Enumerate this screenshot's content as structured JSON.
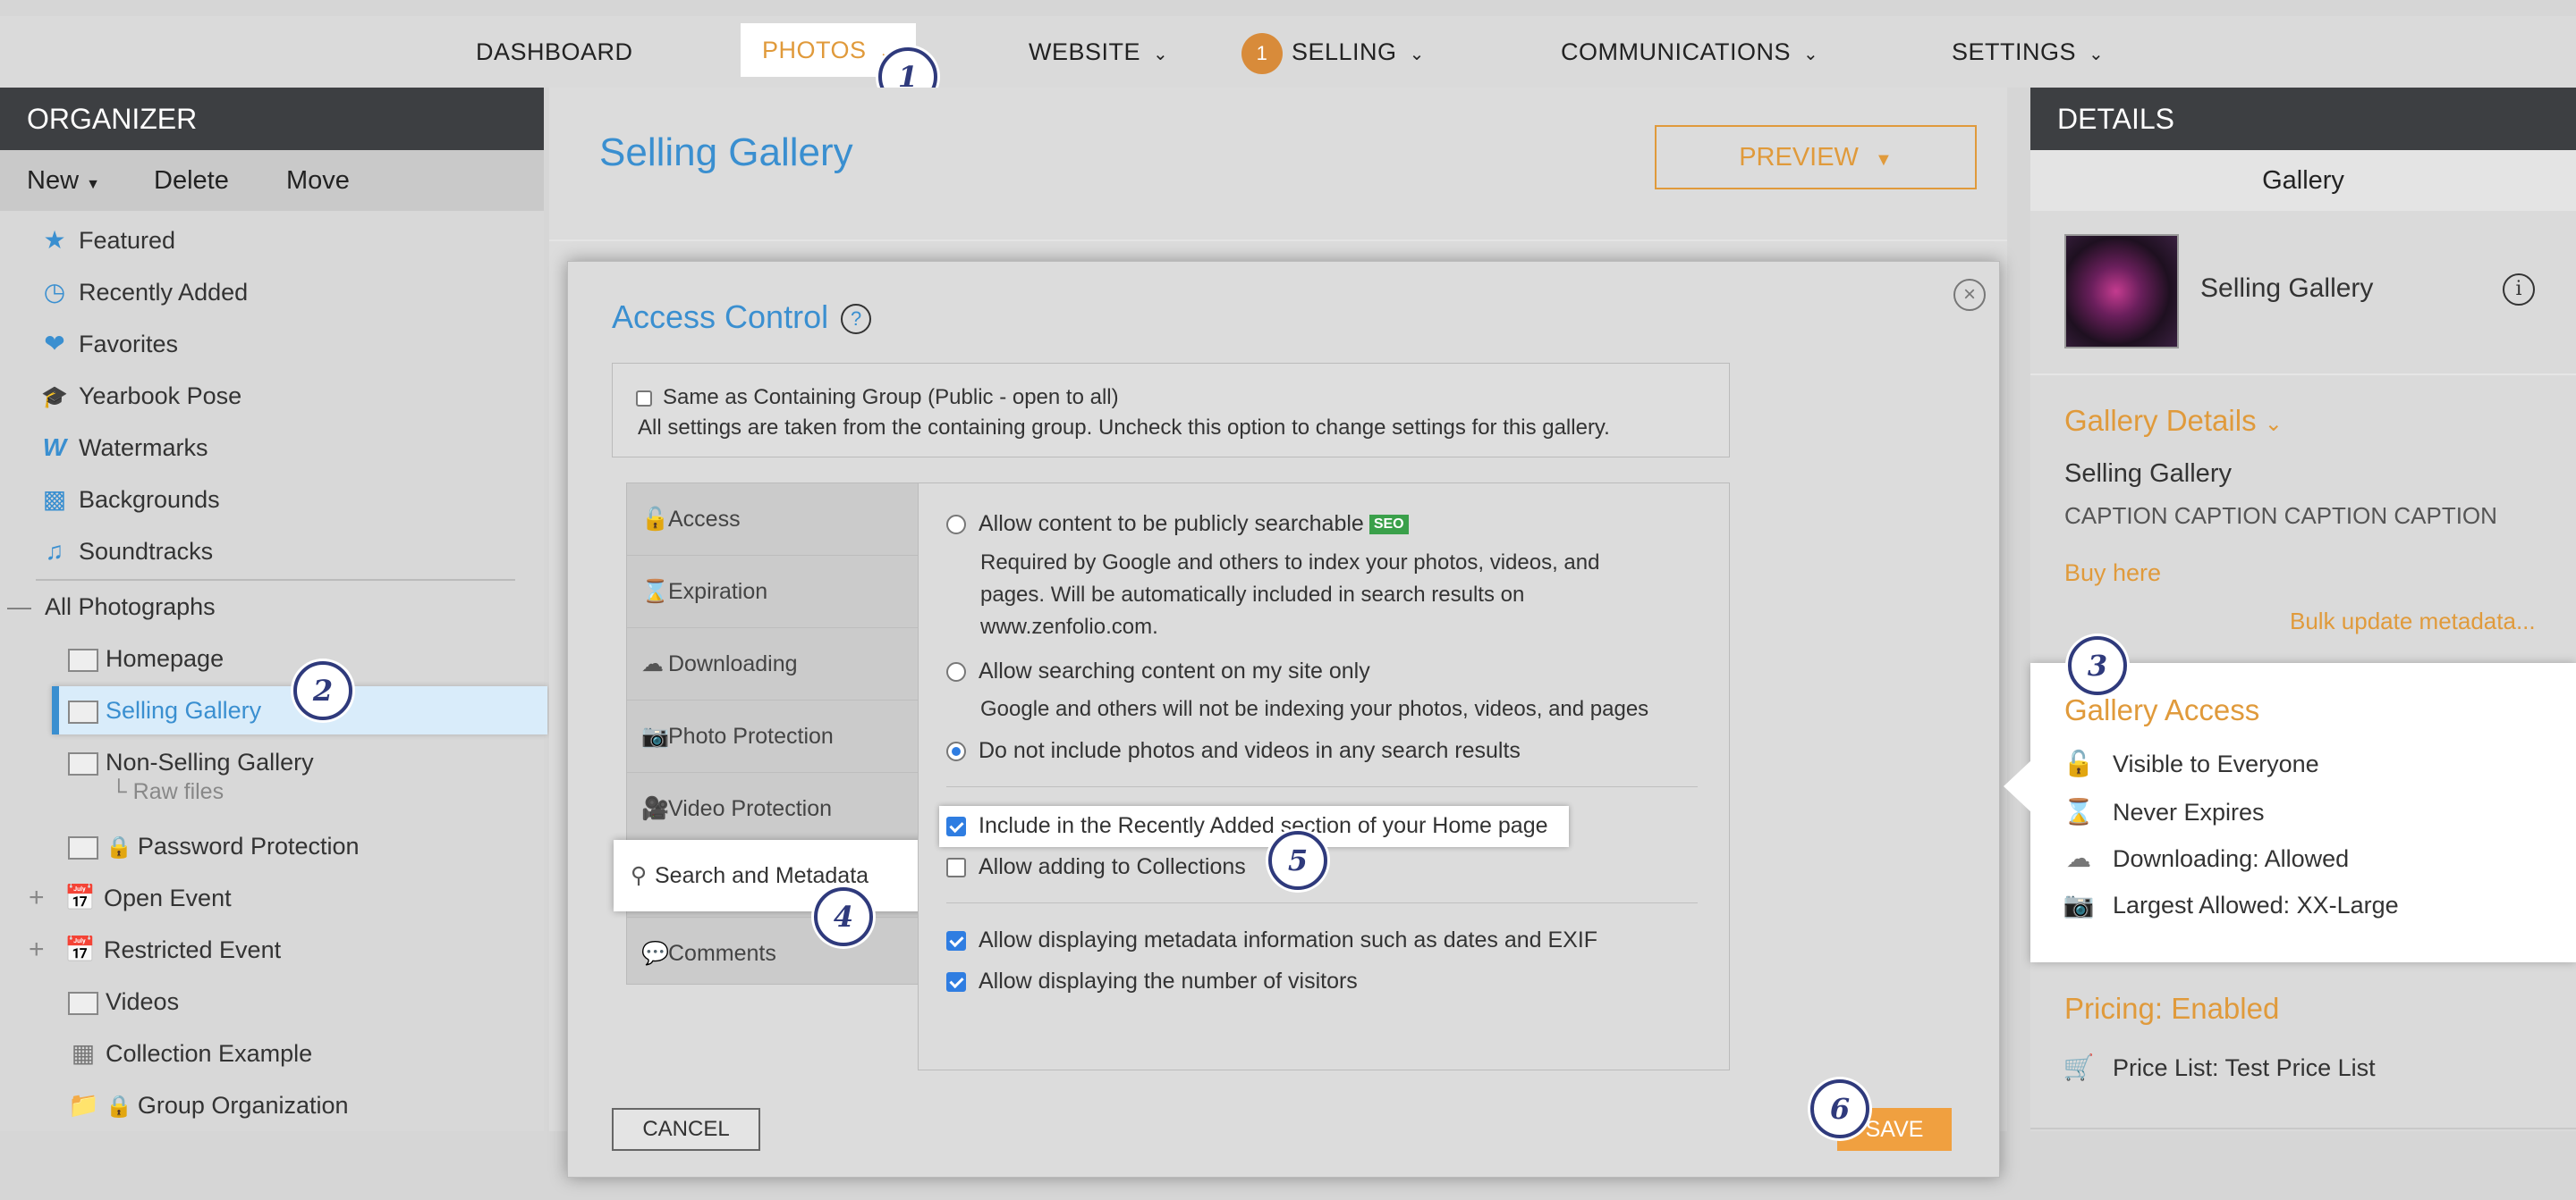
{
  "nav": {
    "dashboard": "DASHBOARD",
    "photos": "PHOTOS",
    "website": "WEBSITE",
    "selling": "SELLING",
    "selling_badge": "1",
    "communications": "COMMUNICATIONS",
    "settings": "SETTINGS"
  },
  "organizer": {
    "title": "ORGANIZER",
    "toolbar": {
      "new": "New",
      "delete": "Delete",
      "move": "Move"
    },
    "shortcuts": [
      {
        "label": "Featured",
        "icon": "star-icon"
      },
      {
        "label": "Recently Added",
        "icon": "clock-icon"
      },
      {
        "label": "Favorites",
        "icon": "heart-icon"
      },
      {
        "label": "Yearbook Pose",
        "icon": "graduation-cap-icon"
      },
      {
        "label": "Watermarks",
        "icon": "watermark-icon"
      },
      {
        "label": "Backgrounds",
        "icon": "background-icon"
      },
      {
        "label": "Soundtracks",
        "icon": "music-note-icon"
      }
    ],
    "all_photographs": "All Photographs",
    "items": {
      "homepage": "Homepage",
      "selling_gallery": "Selling Gallery",
      "non_selling_gallery": "Non-Selling Gallery",
      "raw_files": "Raw files",
      "password_protection": "Password Protection",
      "open_event": "Open Event",
      "restricted_event": "Restricted Event",
      "videos": "Videos",
      "collection_example": "Collection Example",
      "group_organization": "Group Organization"
    }
  },
  "main": {
    "gallery_title": "Selling Gallery",
    "preview": "PREVIEW"
  },
  "modal": {
    "title": "Access Control",
    "help": "?",
    "same_as_group": "Same as Containing Group (Public - open to all)",
    "same_as_group_desc": "All settings are taken from the containing group. Uncheck this option to change settings for this gallery.",
    "tabs": {
      "access": "Access",
      "expiration": "Expiration",
      "downloading": "Downloading",
      "photo_protection": "Photo Protection",
      "video_protection": "Video Protection",
      "search_metadata": "Search and Metadata",
      "comments": "Comments"
    },
    "options": {
      "public_search": "Allow content to be publicly searchable",
      "seo_badge": "SEO",
      "public_search_desc_1": "Required by Google and others to index your photos, videos, and",
      "public_search_desc_2": "pages. Will be automatically included in search results on",
      "public_search_desc_3": "www.zenfolio.com.",
      "site_only": "Allow searching content on my site only",
      "site_only_desc": "Google and others will not be indexing your photos, videos, and pages",
      "no_search": "Do not include photos and videos in any search results",
      "recently_added": "Include in the Recently Added section of your Home page",
      "collections": "Allow adding to Collections",
      "metadata": "Allow displaying metadata information such as dates and EXIF",
      "visitors": "Allow displaying the number of visitors"
    },
    "cancel": "CANCEL",
    "save": "SAVE"
  },
  "details": {
    "title": "DETAILS",
    "type": "Gallery",
    "name": "Selling Gallery",
    "info": "i",
    "gallery_details_head": "Gallery Details",
    "gallery_name": "Selling Gallery",
    "caption": "CAPTION CAPTION CAPTION CAPTION",
    "buy_here": "Buy here",
    "bulk_update": "Bulk update metadata...",
    "gallery_access_head": "Gallery Access",
    "access": {
      "visible": "Visible to Everyone",
      "expires": "Never Expires",
      "downloading": "Downloading: Allowed",
      "largest": "Largest Allowed: XX-Large"
    },
    "pricing_head": "Pricing: Enabled",
    "price_list": "Price List: Test Price List"
  },
  "callouts": [
    "1",
    "2",
    "3",
    "4",
    "5",
    "6"
  ],
  "colors": {
    "accent_blue": "#3a8fd0",
    "accent_orange": "#e09a3b",
    "callout_navy": "#2f3a7c",
    "panel_dark": "#3d3f42"
  }
}
